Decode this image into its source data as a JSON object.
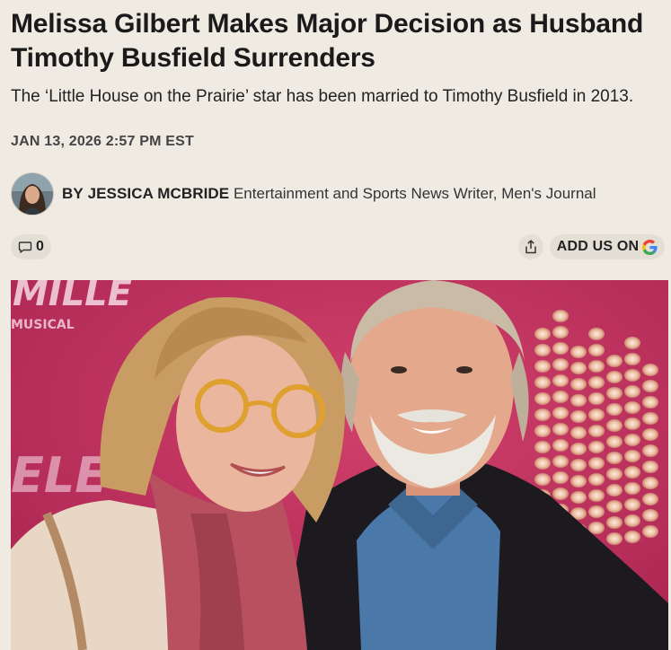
{
  "article": {
    "headline": "Melissa Gilbert Makes Major Decision as Husband Timothy Busfield Surrenders",
    "dek": "The ‘Little House on the Prairie’ star has been married to Timothy Busfield in 2013.",
    "date": "JAN 13, 2026 2:57 PM EST"
  },
  "byline": {
    "prefix": "BY",
    "author": "JESSICA MCBRIDE",
    "role": "Entertainment and Sports News Writer, Men's Journal"
  },
  "actions": {
    "comment_count": "0",
    "comment_icon": "comment-icon",
    "share_icon": "share-icon",
    "add_us_label": "ADD US ON",
    "google_icon": "google-g-icon"
  },
  "photo": {
    "backdrop_text": [
      "MILLE",
      "MUSICAL",
      "ELE"
    ]
  },
  "colors": {
    "background": "#efebe3",
    "pill": "#e4dfd5",
    "backdrop": "#c0345e"
  }
}
